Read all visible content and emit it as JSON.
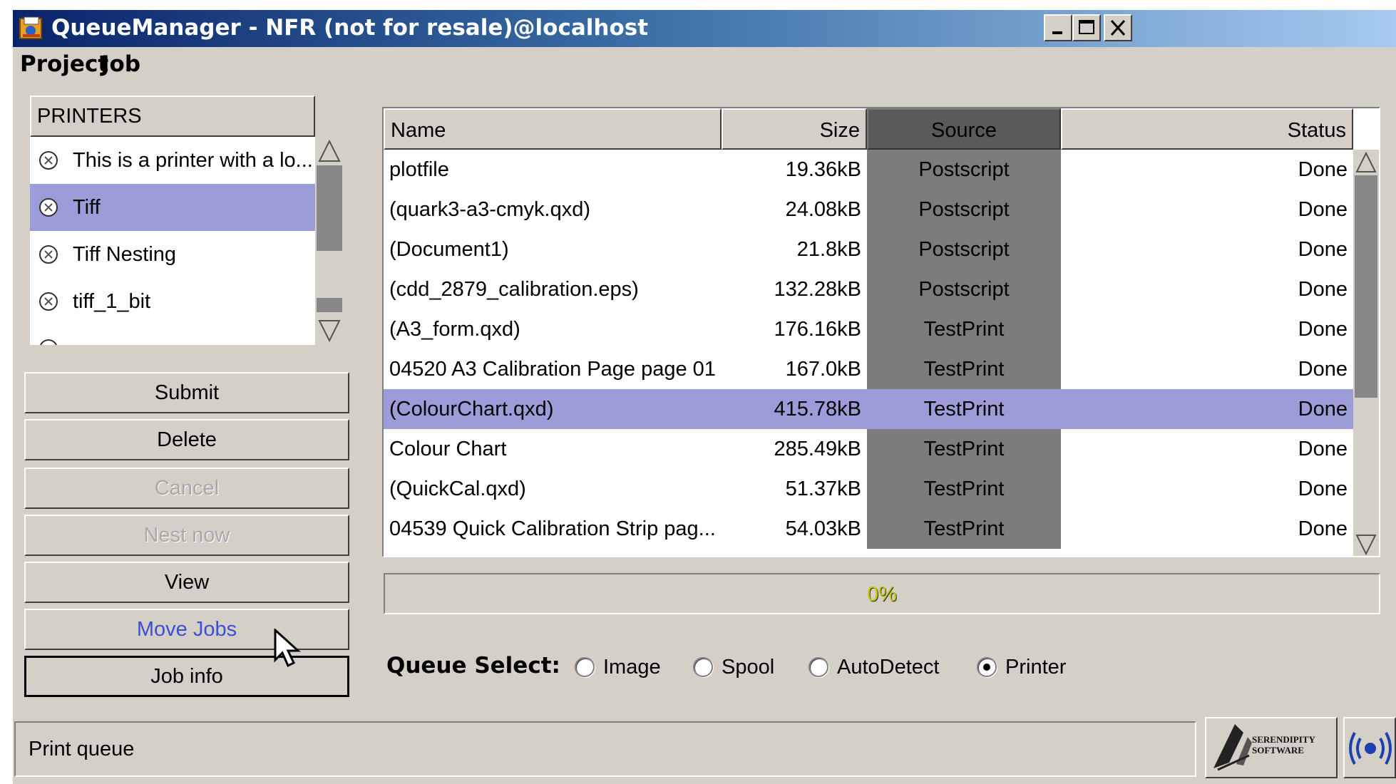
{
  "window": {
    "title": "QueueManager - NFR (not for resale)@localhost",
    "controls": {
      "minimize": "_",
      "maximize": "□",
      "close": "✕"
    }
  },
  "menu": [
    "Project",
    "Job"
  ],
  "printers": {
    "header": "PRINTERS",
    "items": [
      {
        "label": "This is a printer with a lo...",
        "selected": false
      },
      {
        "label": "Tiff",
        "selected": true
      },
      {
        "label": "Tiff Nesting",
        "selected": false
      },
      {
        "label": "tiff_1_bit",
        "selected": false
      }
    ]
  },
  "buttons": [
    {
      "label": "Submit",
      "state": "enabled"
    },
    {
      "label": "Delete",
      "state": "enabled"
    },
    {
      "label": "Cancel",
      "state": "disabled"
    },
    {
      "label": "Nest now",
      "state": "disabled"
    },
    {
      "label": "View",
      "state": "enabled"
    },
    {
      "label": "Move Jobs",
      "state": "hover"
    },
    {
      "label": "Job info",
      "state": "default"
    }
  ],
  "jobs": {
    "columns": [
      "Name",
      "Size",
      "Source",
      "Status"
    ],
    "rows": [
      {
        "name": "plotfile",
        "size": "19.36kB",
        "source": "Postscript",
        "status": "Done",
        "selected": false
      },
      {
        "name": "(quark3-a3-cmyk.qxd)",
        "size": "24.08kB",
        "source": "Postscript",
        "status": "Done",
        "selected": false
      },
      {
        "name": "(Document1)",
        "size": "21.8kB",
        "source": "Postscript",
        "status": "Done",
        "selected": false
      },
      {
        "name": "(cdd_2879_calibration.eps)",
        "size": "132.28kB",
        "source": "Postscript",
        "status": "Done",
        "selected": false
      },
      {
        "name": "(A3_form.qxd)",
        "size": "176.16kB",
        "source": "TestPrint",
        "status": "Done",
        "selected": false
      },
      {
        "name": "04520 A3 Calibration Page page 01",
        "size": "167.0kB",
        "source": "TestPrint",
        "status": "Done",
        "selected": false
      },
      {
        "name": "(ColourChart.qxd)",
        "size": "415.78kB",
        "source": "TestPrint",
        "status": "Done",
        "selected": true
      },
      {
        "name": "Colour Chart",
        "size": "285.49kB",
        "source": "TestPrint",
        "status": "Done",
        "selected": false
      },
      {
        "name": "(QuickCal.qxd)",
        "size": "51.37kB",
        "source": "TestPrint",
        "status": "Done",
        "selected": false
      },
      {
        "name": "04539 Quick Calibration Strip pag...",
        "size": "54.03kB",
        "source": "TestPrint",
        "status": "Done",
        "selected": false
      }
    ]
  },
  "progress": {
    "label": "0%",
    "value": 0
  },
  "queue_select": {
    "label": "Queue Select:",
    "options": [
      {
        "label": "Image",
        "checked": false
      },
      {
        "label": "Spool",
        "checked": false
      },
      {
        "label": "AutoDetect",
        "checked": false
      },
      {
        "label": "Printer",
        "checked": true
      }
    ]
  },
  "statusbar": {
    "text": "Print queue"
  },
  "logo": {
    "text": "SERENDIPITY SOFTWARE"
  },
  "colors": {
    "selection": "#9c9cd8",
    "title_start": "#0a246a",
    "title_end": "#a6caf0",
    "face": "#d4d0c8",
    "source_col": "#7c7c7c",
    "highlight_text": "#3b4fd6"
  }
}
